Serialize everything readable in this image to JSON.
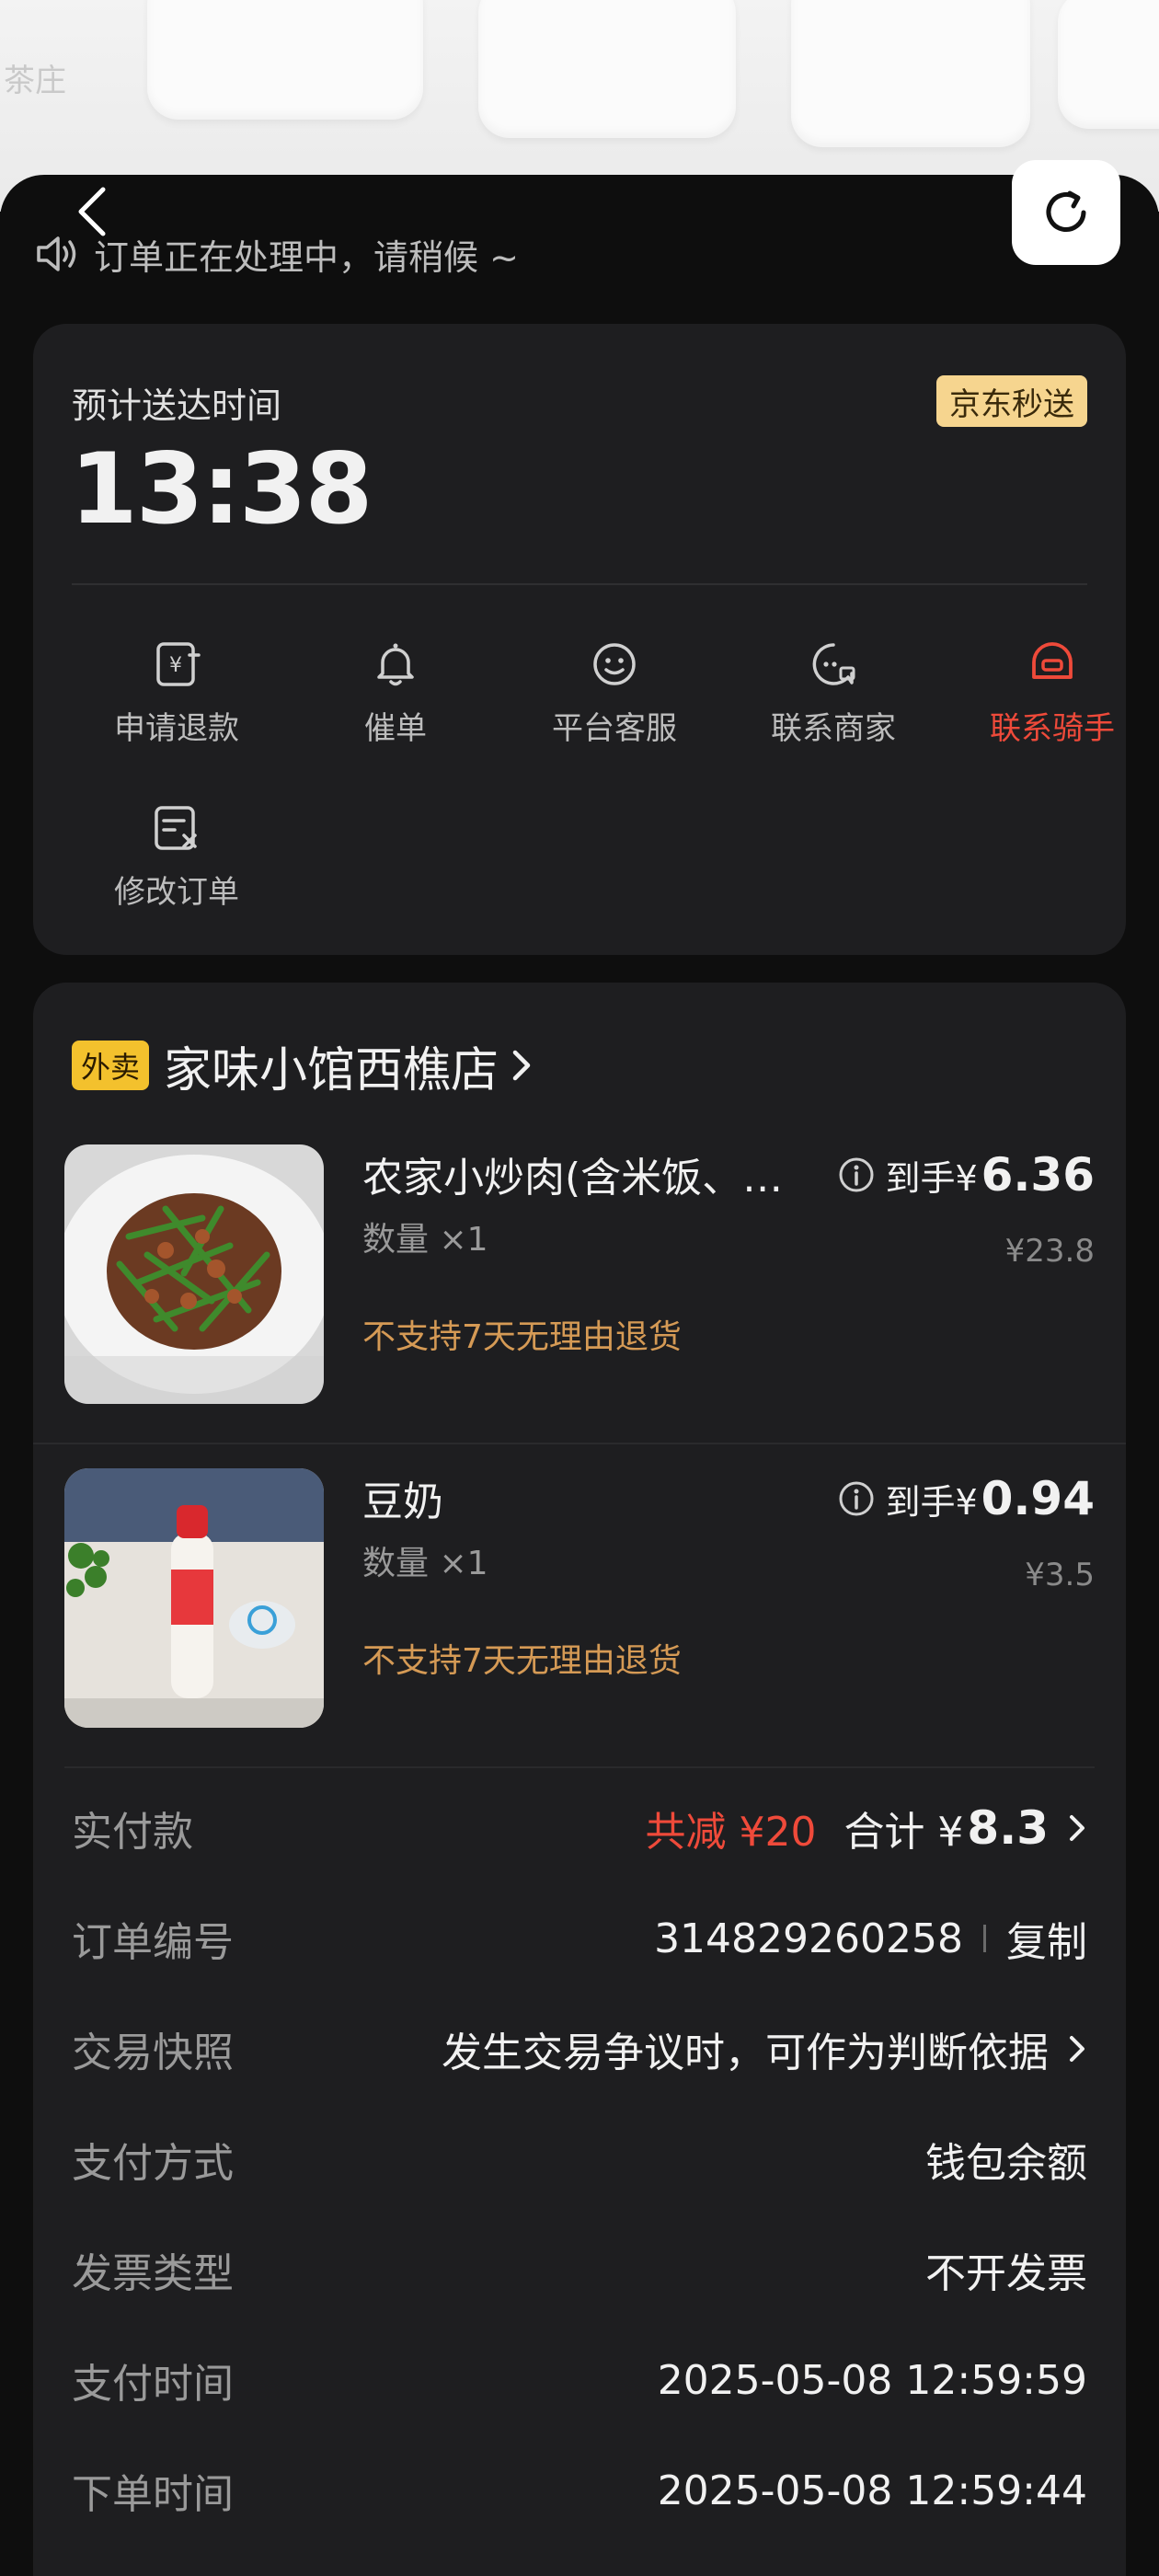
{
  "background": {
    "shop_partial_text": "茶庄"
  },
  "notice": {
    "text": "订单正在处理中，请稍候 ~"
  },
  "delivery": {
    "label": "预计送达时间",
    "time": "13:38",
    "badge": "京东秒送"
  },
  "actions": [
    {
      "label": "申请退款",
      "icon": "refund-icon"
    },
    {
      "label": "催单",
      "icon": "bell-icon"
    },
    {
      "label": "平台客服",
      "icon": "service-icon"
    },
    {
      "label": "联系商家",
      "icon": "merchant-icon"
    },
    {
      "label": "联系骑手",
      "icon": "rider-icon",
      "highlight": true
    },
    {
      "label": "修改订单",
      "icon": "edit-order-icon"
    }
  ],
  "shop": {
    "tag": "外卖",
    "name": "家味小馆西樵店"
  },
  "items": [
    {
      "name": "农家小炒肉(含米饭、…",
      "qty": "数量 ×1",
      "policy": "不支持7天无理由退货",
      "price_prefix": "到手¥",
      "price": "6.36",
      "original": "¥23.8"
    },
    {
      "name": "豆奶",
      "qty": "数量 ×1",
      "policy": "不支持7天无理由退货",
      "price_prefix": "到手¥",
      "price": "0.94",
      "original": "¥3.5"
    }
  ],
  "summary": {
    "paid_label": "实付款",
    "discount": "共减 ¥20",
    "total_prefix": "合计 ¥",
    "total": "8.3",
    "order_no_label": "订单编号",
    "order_no": "314829260258",
    "copy": "复制",
    "snapshot_label": "交易快照",
    "snapshot_value": "发生交易争议时，可作为判断依据",
    "pay_method_label": "支付方式",
    "pay_method": "钱包余额",
    "invoice_label": "发票类型",
    "invoice": "不开发票",
    "pay_time_label": "支付时间",
    "pay_time": "2025-05-08 12:59:59",
    "order_time_label": "下单时间",
    "order_time": "2025-05-08 12:59:44"
  },
  "colors": {
    "accent_red": "#ef4a3a",
    "warn_orange": "#d59a55",
    "badge_gold": "#f6d58f",
    "tag_yellow": "#f3c12d"
  }
}
